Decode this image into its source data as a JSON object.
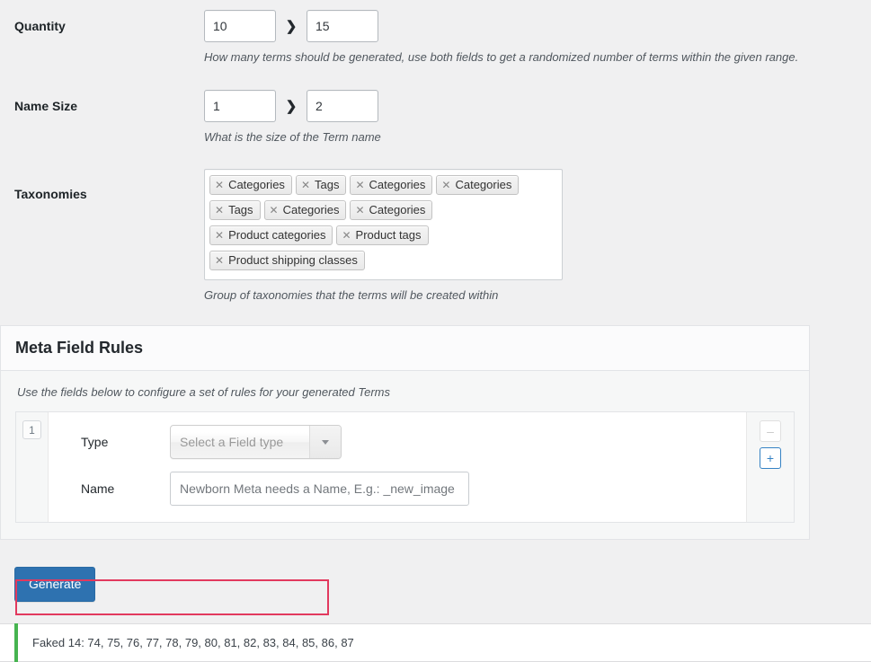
{
  "fields": {
    "quantity": {
      "label": "Quantity",
      "min_value": "10",
      "max_value": "15",
      "separator": "❯",
      "description": "How many terms should be generated, use both fields to get a randomized number of terms within the given range."
    },
    "name_size": {
      "label": "Name Size",
      "min_value": "1",
      "max_value": "2",
      "separator": "❯",
      "description": "What is the size of the Term name"
    },
    "taxonomies": {
      "label": "Taxonomies",
      "description": "Group of taxonomies that the terms will be created within",
      "remove_glyph": "✕",
      "chips": [
        "Categories",
        "Tags",
        "Categories",
        "Categories",
        "Tags",
        "Categories",
        "Categories",
        "Product categories",
        "Product tags",
        "Product shipping classes"
      ]
    }
  },
  "meta_field_rules": {
    "title": "Meta Field Rules",
    "description": "Use the fields below to configure a set of rules for your generated Terms",
    "rules": [
      {
        "index": "1",
        "type": {
          "label": "Type",
          "placeholder": "Select a Field type",
          "arrow_icon": "chevron-down-icon"
        },
        "name": {
          "label": "Name",
          "value": "",
          "placeholder": "Newborn Meta needs a Name, E.g.: _new_image"
        },
        "remove_label": "–",
        "add_label": "+"
      }
    ]
  },
  "actions": {
    "generate_label": "Generate"
  },
  "results": {
    "message": "Faked 14: 74, 75, 76, 77, 78, 79, 80, 81, 82, 83, 84, 85, 86, 87",
    "accent_color": "#46b450",
    "highlight_color": "#e2395e"
  },
  "colors": {
    "page_background": "#f0f0f1",
    "primary_button": "#2e72b0",
    "card_background": "#ffffff"
  }
}
